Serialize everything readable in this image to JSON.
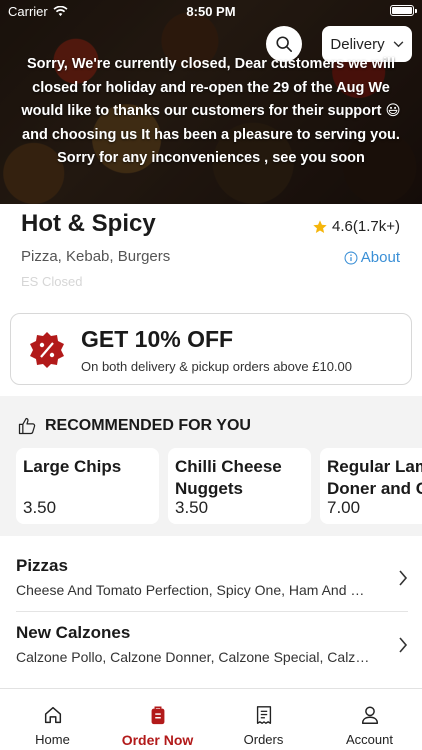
{
  "status_bar": {
    "carrier": "Carrier",
    "time": "8:50 PM"
  },
  "header": {
    "search_icon": "search-icon",
    "mode_label": "Delivery",
    "notice": "Sorry, We're currently closed, Dear customers we will closed for holiday and re-open the 29 of the Aug We would like to thanks our customers for their support 😃 and choosing us It has been a pleasure to serving you. Sorry for any inconveniences , see you soon"
  },
  "restaurant": {
    "name": "Hot & Spicy",
    "rating": "4.6(1.7k+)",
    "cuisines": "Pizza, Kebab, Burgers",
    "about_label": "About",
    "status": "ES Closed"
  },
  "offer": {
    "title": "GET 10% OFF",
    "subtitle": "On both delivery & pickup orders above £10.00"
  },
  "recommended": {
    "heading": "RECOMMENDED FOR YOU",
    "items": [
      {
        "name": "Large Chips",
        "price": "3.50"
      },
      {
        "name": "Chilli Cheese Nuggets",
        "price": "3.50"
      },
      {
        "name": "Regular Lamb Doner and Chips",
        "price": "7.00"
      }
    ]
  },
  "categories": [
    {
      "title": "Pizzas",
      "description": "Cheese And Tomato Perfection, Spicy One, Ham And Pineapple, Hot & Spicy Special"
    },
    {
      "title": "New Calzones",
      "description": "Calzone Pollo, Calzone Donner, Calzone Special, Calzone Vegetarian"
    }
  ],
  "tabs": [
    {
      "label": "Home",
      "icon": "home-icon"
    },
    {
      "label": "Order Now",
      "icon": "order-bag-icon"
    },
    {
      "label": "Orders",
      "icon": "receipt-icon"
    },
    {
      "label": "Account",
      "icon": "person-icon"
    }
  ],
  "colors": {
    "accent": "#b21a1a",
    "link": "#3a8fd6",
    "star": "#f5b50a"
  }
}
